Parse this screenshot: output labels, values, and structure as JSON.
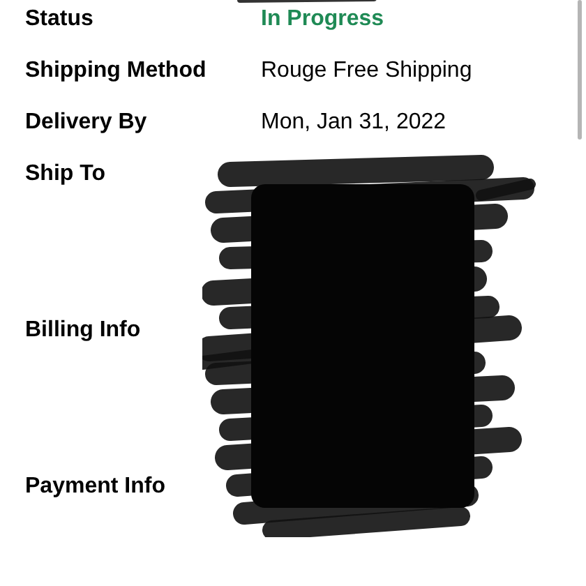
{
  "rows": [
    {
      "label": "Status",
      "value": "In Progress",
      "kind": "status"
    },
    {
      "label": "Shipping Method",
      "value": "Rouge Free Shipping",
      "kind": "text"
    },
    {
      "label": "Delivery By",
      "value": "Mon, Jan 31, 2022",
      "kind": "text"
    },
    {
      "label": "Ship To",
      "kind": "block"
    },
    {
      "label": "Billing Info",
      "kind": "block"
    },
    {
      "label": "Payment Info",
      "kind": "block"
    }
  ]
}
